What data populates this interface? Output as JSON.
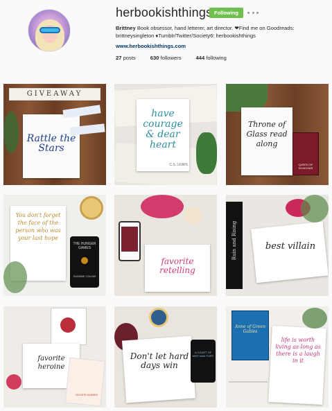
{
  "profile": {
    "username": "herbookishthings",
    "follow_label": "Following",
    "bio_name": "Brittney",
    "bio_text": " Book obsessor, hand letterer, art director. ❤Find me on Goodreads:",
    "bio_line2": "brittneysingleton ♦Tumblr/Twitter/Society6: herbookishthings",
    "website": "www.herbookishthings.com",
    "posts_count": "27",
    "posts_label": "posts",
    "followers_count": "630",
    "followers_label": "followers",
    "following_count": "444",
    "following_label": "following"
  },
  "posts": [
    {
      "title": "GIVEAWAY",
      "text": "Rattle the Stars"
    },
    {
      "text": "have courage & dear heart",
      "caption": "C.S. LEWIS"
    },
    {
      "text": "Throne of Glass read along",
      "book": "QUEEN OF SHADOWS"
    },
    {
      "text": "You don't forget the face of the person who was your last hope",
      "book": "THE HUNGER GAMES",
      "author": "SUZANNE COLLINS"
    },
    {
      "text": "favorite retelling"
    },
    {
      "text": "best villain",
      "book": "Ruin and Rising"
    },
    {
      "text": "favorite heroine",
      "book": "CELESTE ALVARES"
    },
    {
      "text": "Don't let hard days win",
      "book": "A COURT OF MIST AND FURY"
    },
    {
      "text": "life is worth living as long as there is a laugh in it",
      "book": "Anne of Green Gables"
    }
  ]
}
